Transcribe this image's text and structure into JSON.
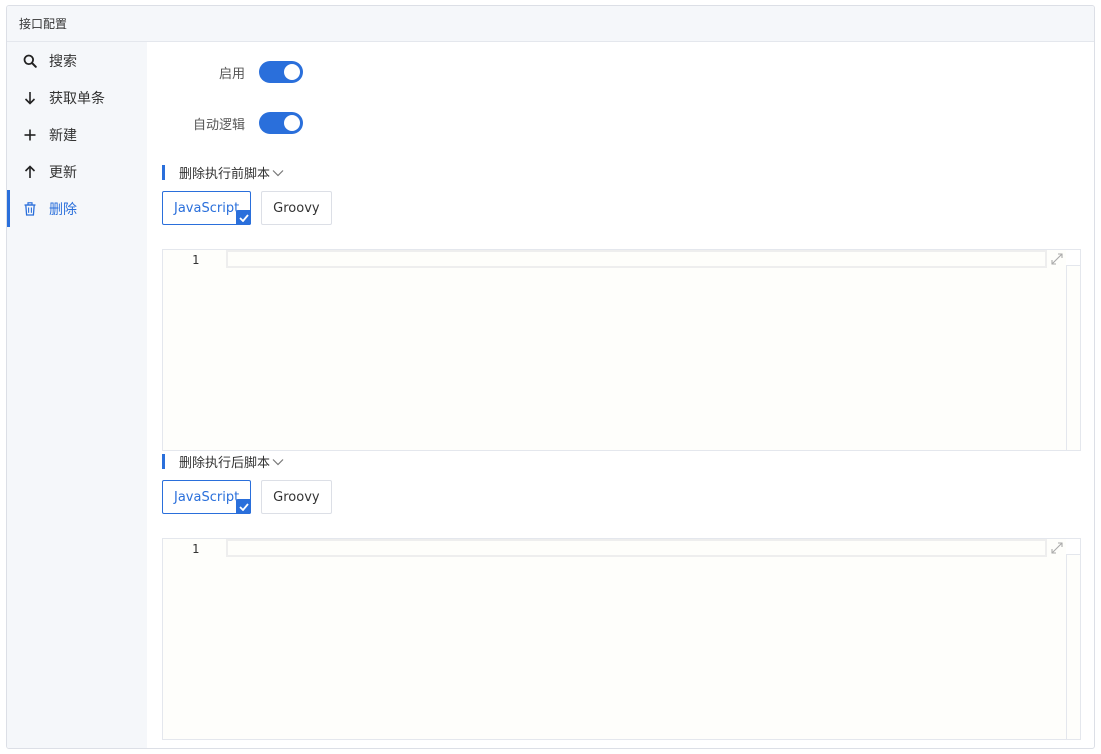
{
  "panel": {
    "title": "接口配置"
  },
  "sidebar": {
    "items": [
      {
        "label": "搜索",
        "icon": "search-icon"
      },
      {
        "label": "获取单条",
        "icon": "arrow-down-icon"
      },
      {
        "label": "新建",
        "icon": "plus-icon"
      },
      {
        "label": "更新",
        "icon": "arrow-up-icon"
      },
      {
        "label": "删除",
        "icon": "trash-icon",
        "active": true
      }
    ]
  },
  "form": {
    "enable": {
      "label": "启用",
      "value": true
    },
    "auto_logic": {
      "label": "自动逻辑",
      "value": true
    }
  },
  "before_script": {
    "title": "删除执行前脚本",
    "languages": [
      "JavaScript",
      "Groovy"
    ],
    "selected": "JavaScript",
    "line_number": "1",
    "code": ""
  },
  "after_script": {
    "title": "删除执行后脚本",
    "languages": [
      "JavaScript",
      "Groovy"
    ],
    "selected": "JavaScript",
    "line_number": "1",
    "code": ""
  },
  "colors": {
    "accent": "#2a6fdb",
    "sidebar_bg": "#f5f7fa",
    "editor_bg": "#fefefb"
  }
}
